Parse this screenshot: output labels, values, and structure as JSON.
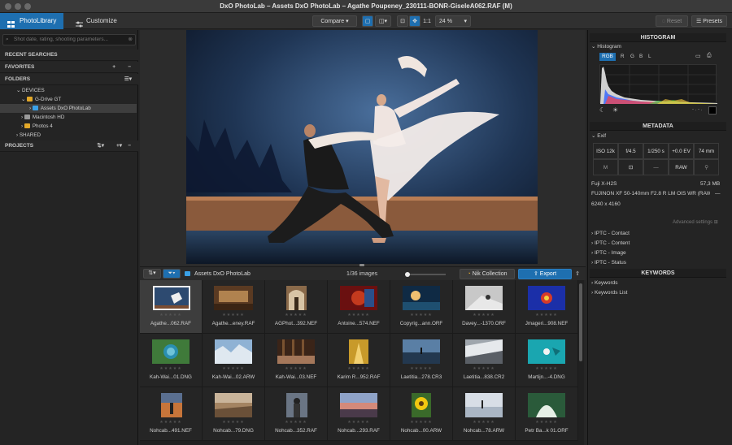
{
  "window": {
    "title": "DxO PhotoLab – Assets DxO PhotoLab – Agathe Poupeney_230111-BONR-GiseleA062.RAF (M)"
  },
  "toolbar": {
    "tab_library": "PhotoLibrary",
    "tab_customize": "Customize",
    "compare_label": "Compare",
    "one_to_one": "1:1",
    "zoom_value": "24 %",
    "reset_label": "Reset",
    "presets_label": "Presets"
  },
  "left": {
    "search_placeholder": "Shot date, rating, shooting parameters...",
    "recent_searches": "RECENT SEARCHES",
    "favorites": "FAVORITES",
    "folders": "FOLDERS",
    "devices": "DEVICES",
    "drive": "G-Drive GT",
    "assets_folder": "Assets DxO PhotoLab",
    "macintosh": "Macintosh HD",
    "photos4": "Photos 4",
    "shared": "SHARED",
    "projects": "PROJECTS"
  },
  "filmstrip": {
    "folder_name": "Assets DxO PhotoLab",
    "image_count": "1/36 images",
    "nik_label": "Nik Collection",
    "export_label": "Export"
  },
  "thumbnails": [
    {
      "name": "Agathe...062.RAF"
    },
    {
      "name": "Agathe...eney.RAF"
    },
    {
      "name": "AGPhot...392.NEF"
    },
    {
      "name": "Antoine...574.NEF"
    },
    {
      "name": "Copyrig...ann.ORF"
    },
    {
      "name": "Davey...-1370.ORF"
    },
    {
      "name": "Jmageri...908.NEF"
    },
    {
      "name": "Kah-Wai...01.DNG"
    },
    {
      "name": "Kah-Wai...02.ARW"
    },
    {
      "name": "Kah-Wai...03.NEF"
    },
    {
      "name": "Karim R...952.RAF"
    },
    {
      "name": "Laetitia...278.CR3"
    },
    {
      "name": "Laetitia...838.CR2"
    },
    {
      "name": "Martijn...-4.DNG"
    },
    {
      "name": "Nohcab...491.NEF"
    },
    {
      "name": "Nohcab...79.DNG"
    },
    {
      "name": "Nohcab...352.RAF"
    },
    {
      "name": "Nohcab...293.RAF"
    },
    {
      "name": "Nohcab...00.ARW"
    },
    {
      "name": "Nohcab...78.ARW"
    },
    {
      "name": "Petr Ba...k 01.ORF"
    }
  ],
  "right": {
    "histogram_header": "HISTOGRAM",
    "histogram_label": "Histogram",
    "ch_rgb": "RGB",
    "ch_r": "R",
    "ch_g": "G",
    "ch_b": "B",
    "ch_l": "L",
    "metadata_header": "METADATA",
    "exif_label": "Exif",
    "iso": "ISO 12k",
    "aperture": "f/4.5",
    "shutter": "1/250 s",
    "ev": "+0.0 EV",
    "focal": "74 mm",
    "mode": "M",
    "flash": "—",
    "format": "RAW",
    "camera": "Fuji X-H2S",
    "filesize": "57,3 MB",
    "lens": "FUJINON XF 50-140mm F2.8 R LM OIS WR (RAW)",
    "lens_extra": "—",
    "dimensions": "6240 x 4160",
    "advanced": "Advanced settings",
    "iptc_contact": "IPTC - Contact",
    "iptc_content": "IPTC - Content",
    "iptc_image": "IPTC - Image",
    "iptc_status": "IPTC - Status",
    "keywords_header": "KEYWORDS",
    "keywords": "Keywords",
    "keywords_list": "Keywords List"
  }
}
